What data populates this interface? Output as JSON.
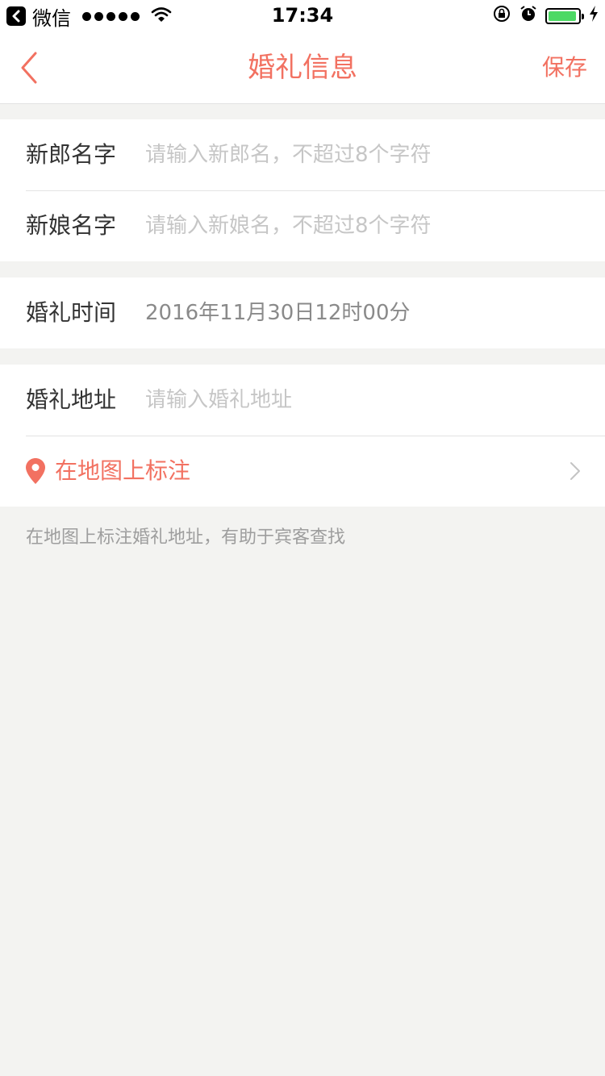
{
  "status_bar": {
    "app_name": "微信",
    "time": "17:34",
    "battery_level": 0.95,
    "icons": [
      "back-app-icon",
      "signal-dots-icon",
      "wifi-icon",
      "rotation-lock-icon",
      "alarm-icon",
      "battery-icon",
      "charging-icon"
    ]
  },
  "header": {
    "title": "婚礼信息",
    "save_label": "保存",
    "back_icon": "chevron-left-icon",
    "accent_color": "#f27161"
  },
  "form": {
    "groom": {
      "label": "新郎名字",
      "placeholder": "请输入新郎名，不超过8个字符"
    },
    "bride": {
      "label": "新娘名字",
      "placeholder": "请输入新娘名，不超过8个字符"
    },
    "time": {
      "label": "婚礼时间",
      "value": "2016年11月30日12时00分"
    },
    "address": {
      "label": "婚礼地址",
      "placeholder": "请输入婚礼地址"
    },
    "map": {
      "label": "在地图上标注",
      "icon": "location-pin-icon",
      "chevron": "chevron-right-icon"
    }
  },
  "hint": "在地图上标注婚礼地址，有助于宾客查找"
}
